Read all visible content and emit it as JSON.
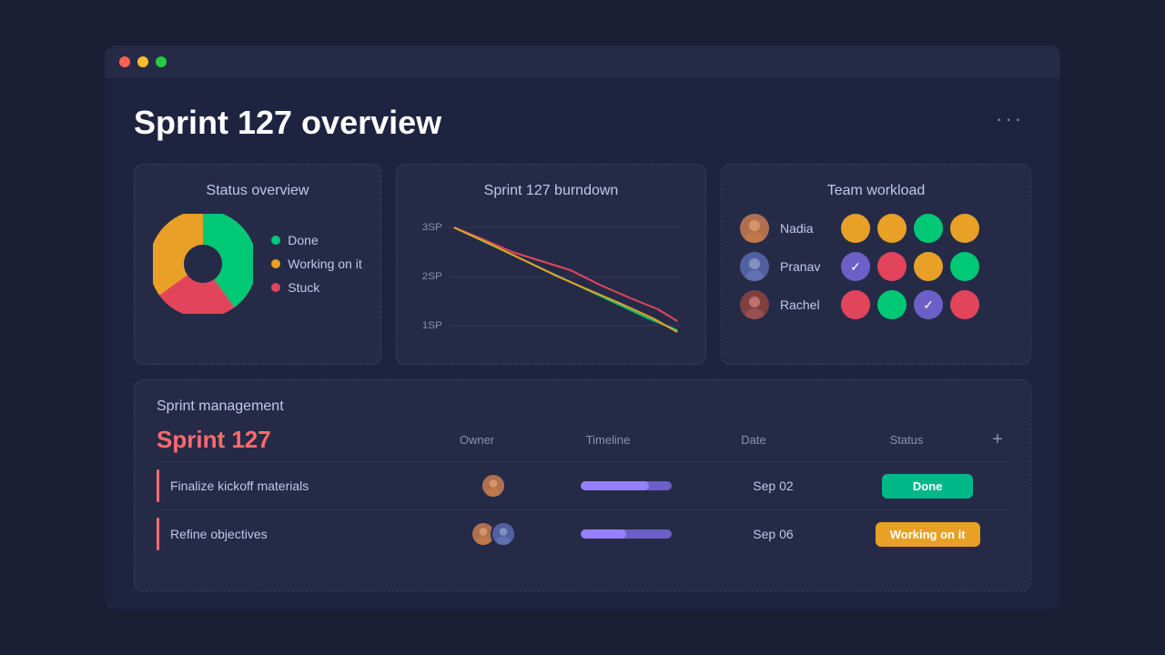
{
  "window": {
    "titlebar_dots": [
      "red",
      "yellow",
      "green"
    ]
  },
  "header": {
    "title": "Sprint 127 overview",
    "more_label": "···"
  },
  "status_overview": {
    "card_title": "Status overview",
    "legend": [
      {
        "label": "Done",
        "color": "#00c875"
      },
      {
        "label": "Working on it",
        "color": "#e8a026"
      },
      {
        "label": "Stuck",
        "color": "#e2445c"
      }
    ],
    "pie": {
      "done_pct": 40,
      "working_pct": 35,
      "stuck_pct": 25
    }
  },
  "burndown": {
    "card_title": "Sprint 127 burndown",
    "y_labels": [
      "3SP",
      "2SP",
      "1SP"
    ]
  },
  "team_workload": {
    "card_title": "Team workload",
    "members": [
      {
        "name": "Nadia",
        "statuses": [
          {
            "type": "working",
            "color": "#e8a026"
          },
          {
            "type": "working",
            "color": "#e8a026"
          },
          {
            "type": "done",
            "color": "#00c875"
          },
          {
            "type": "working",
            "color": "#e8a026"
          }
        ]
      },
      {
        "name": "Pranav",
        "statuses": [
          {
            "type": "check",
            "color": "#6c5fc7"
          },
          {
            "type": "stuck",
            "color": "#e2445c"
          },
          {
            "type": "working",
            "color": "#e8a026"
          },
          {
            "type": "done",
            "color": "#00c875"
          }
        ]
      },
      {
        "name": "Rachel",
        "statuses": [
          {
            "type": "stuck",
            "color": "#e2445c"
          },
          {
            "type": "done",
            "color": "#00c875"
          },
          {
            "type": "check",
            "color": "#6c5fc7"
          },
          {
            "type": "stuck",
            "color": "#e2445c"
          }
        ]
      }
    ]
  },
  "sprint_management": {
    "section_title": "Sprint management",
    "sprint_name": "Sprint 127",
    "columns": [
      "Owner",
      "Timeline",
      "Date",
      "Status"
    ],
    "tasks": [
      {
        "name": "Finalize kickoff materials",
        "owner_count": 1,
        "timeline_fill": 75,
        "date": "Sep 02",
        "status": "Done",
        "status_type": "done"
      },
      {
        "name": "Refine objectives",
        "owner_count": 2,
        "timeline_fill": 50,
        "date": "Sep 06",
        "status": "Working on it",
        "status_type": "working"
      }
    ]
  }
}
